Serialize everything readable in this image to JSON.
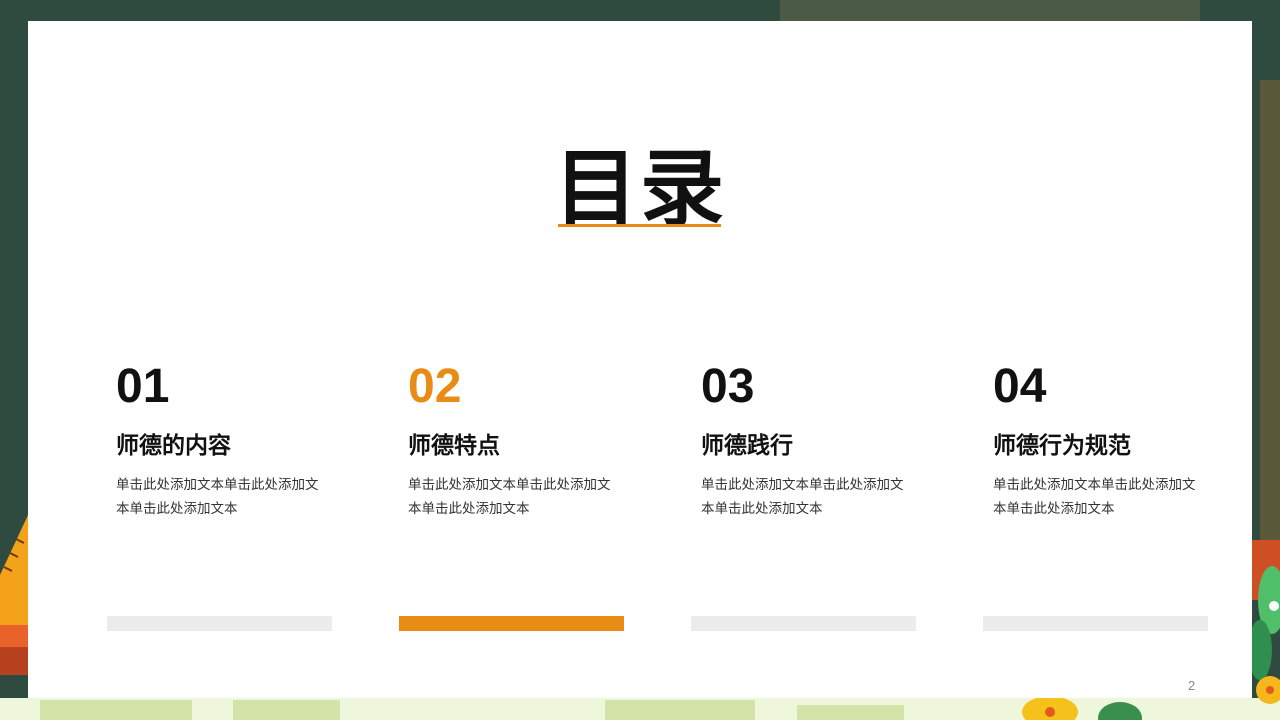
{
  "slide": {
    "title": "目录",
    "accent_color": "#e88c16",
    "page_number": "2",
    "sections": [
      {
        "number": "01",
        "heading": "师德的内容",
        "desc": "单击此处添加文本单击此处添加文本单击此处添加文本",
        "active": false
      },
      {
        "number": "02",
        "heading": "师德特点",
        "desc": "单击此处添加文本单击此处添加文本单击此处添加文本",
        "active": true
      },
      {
        "number": "03",
        "heading": "师德践行",
        "desc": "单击此处添加文本单击此处添加文本单击此处添加文本",
        "active": false
      },
      {
        "number": "04",
        "heading": "师德行为规范",
        "desc": "单击此处添加文本单击此处添加文本单击此处添加文本",
        "active": false
      }
    ]
  }
}
